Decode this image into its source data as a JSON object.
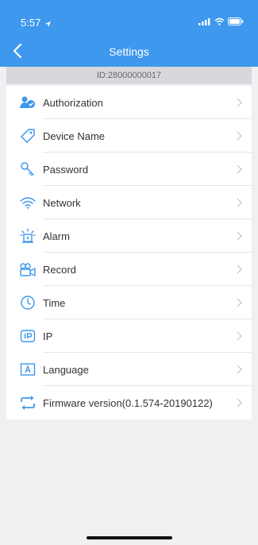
{
  "status_bar": {
    "time": "5:57",
    "location_icon": "location-arrow-icon",
    "signal_icon": "signal-icon",
    "wifi_icon": "wifi-icon",
    "battery_icon": "battery-icon"
  },
  "header": {
    "title": "Settings",
    "back_icon": "chevron-left-icon",
    "background_color": "#3e98ee"
  },
  "device": {
    "id_text": "ID:28000000017"
  },
  "menu": {
    "items": [
      {
        "label": "Authorization",
        "icon": "user-auth-icon"
      },
      {
        "label": "Device Name",
        "icon": "tag-icon"
      },
      {
        "label": "Password",
        "icon": "key-icon"
      },
      {
        "label": "Network",
        "icon": "wifi-icon"
      },
      {
        "label": "Alarm",
        "icon": "alarm-icon"
      },
      {
        "label": "Record",
        "icon": "video-camera-icon"
      },
      {
        "label": "Time",
        "icon": "clock-icon"
      },
      {
        "label": "IP",
        "icon": "ip-icon"
      },
      {
        "label": "Language",
        "icon": "language-icon"
      },
      {
        "label": "Firmware version(0.1.574-20190122)",
        "icon": "refresh-icon"
      }
    ]
  },
  "colors": {
    "accent": "#3e98ee",
    "icon": "#3e98ee",
    "list_background": "#ffffff",
    "page_background": "#f0f0f2"
  }
}
